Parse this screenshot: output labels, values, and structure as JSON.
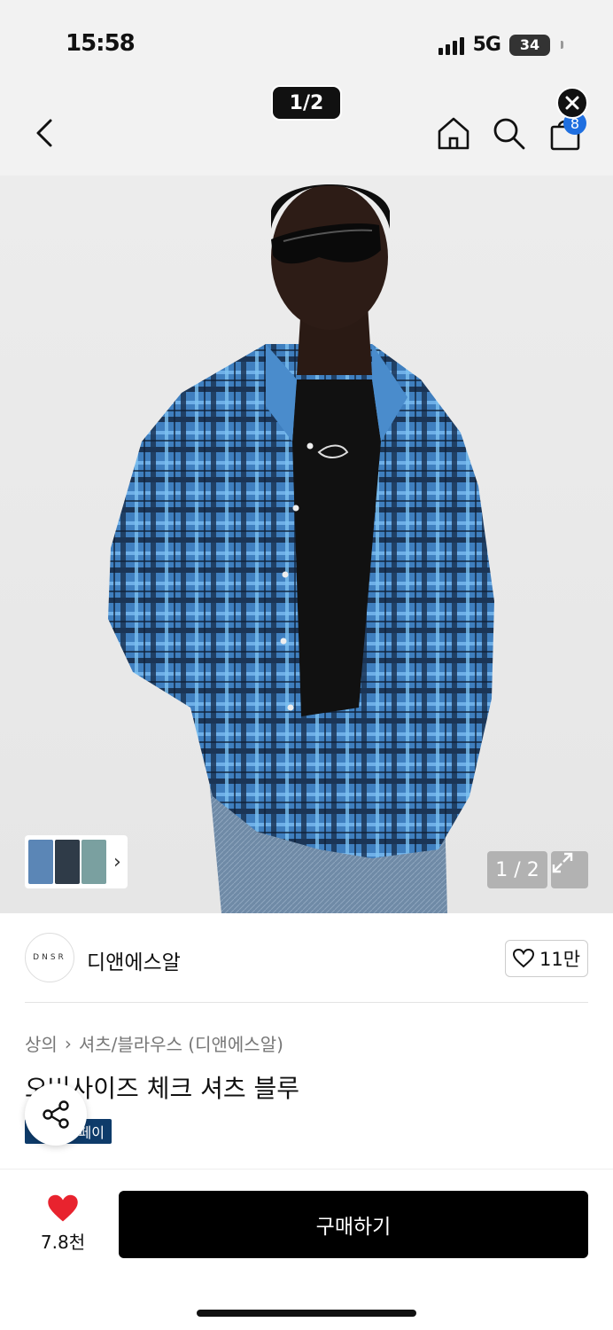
{
  "status_bar": {
    "time": "15:58",
    "network": "5G",
    "battery": "34"
  },
  "header": {
    "page_indicator": "1/2",
    "cart_count": "8"
  },
  "gallery": {
    "counter": "1 / 2"
  },
  "brand": {
    "logo_text": "DNSR",
    "name": "디앤에스알",
    "like_count": "11만"
  },
  "product": {
    "breadcrumb": [
      "상의",
      "셔츠/블라우스 (디앤에스알)"
    ],
    "title": "오버사이즈 체크 셔츠 블루",
    "pay_badge": "페이"
  },
  "bottom": {
    "wish_count": "7.8천",
    "buy_label": "구매하기"
  },
  "colors": {
    "accent_blue": "#1f6fe0",
    "heart_red": "#e8232e",
    "buy_button": "#000000"
  }
}
